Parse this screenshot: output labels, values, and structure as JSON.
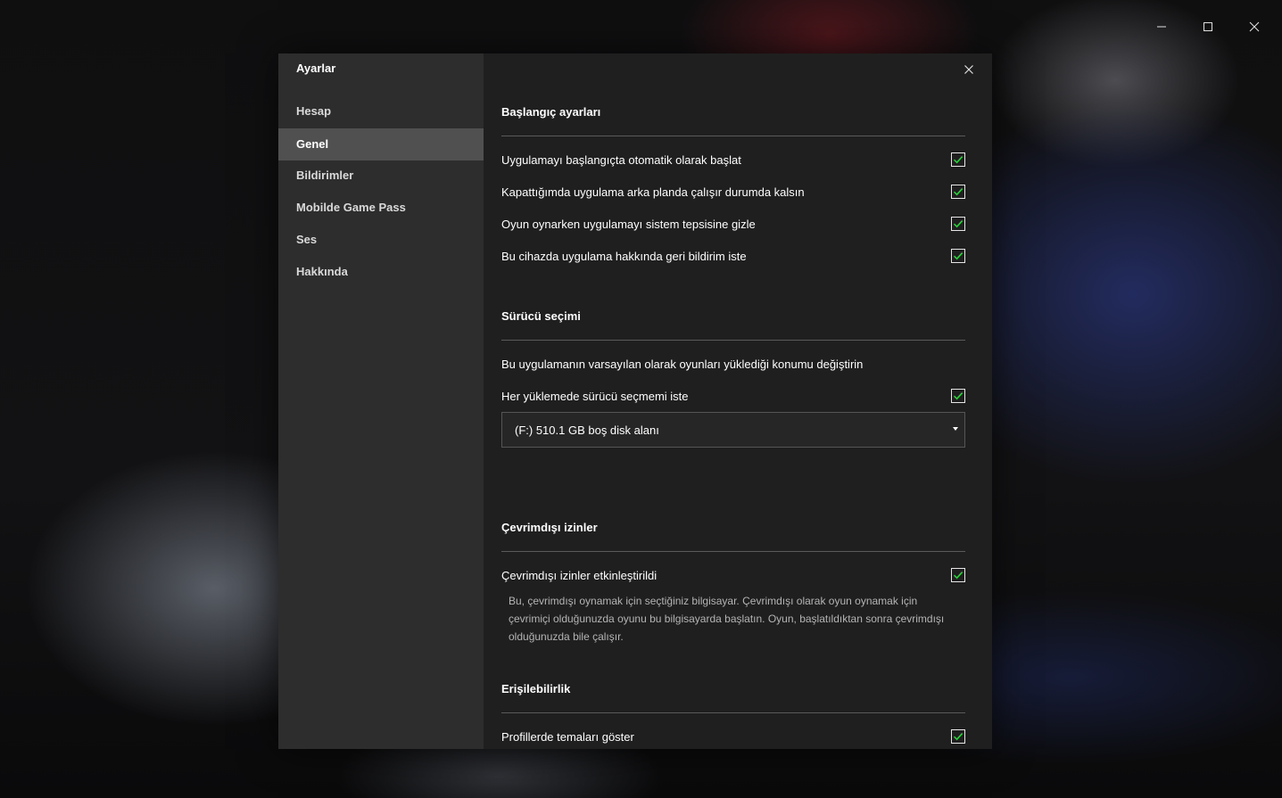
{
  "window_controls": {
    "minimize_icon": "minimize-icon",
    "maximize_icon": "maximize-icon",
    "close_icon": "close-icon"
  },
  "sidebar": {
    "title": "Ayarlar",
    "items": [
      {
        "label": "Hesap",
        "active": false
      },
      {
        "label": "Genel",
        "active": true
      },
      {
        "label": "Bildirimler",
        "active": false
      },
      {
        "label": "Mobilde Game Pass",
        "active": false
      },
      {
        "label": "Ses",
        "active": false
      },
      {
        "label": "Hakkında",
        "active": false
      }
    ]
  },
  "sections": {
    "startup": {
      "title": "Başlangıç ayarları",
      "options": [
        {
          "label": "Uygulamayı başlangıçta otomatik olarak başlat",
          "checked": true
        },
        {
          "label": "Kapattığımda uygulama arka planda çalışır durumda kalsın",
          "checked": true
        },
        {
          "label": "Oyun oynarken uygulamayı sistem tepsisine gizle",
          "checked": true
        },
        {
          "label": "Bu cihazda uygulama hakkında geri bildirim iste",
          "checked": true
        }
      ]
    },
    "drive": {
      "title": "Sürücü seçimi",
      "info": "Bu uygulamanın varsayılan olarak oyunları yüklediği konumu değiştirin",
      "ask_label": "Her yüklemede sürücü seçmemi iste",
      "ask_checked": true,
      "selected_drive": "(F:) 510.1 GB boş disk alanı"
    },
    "offline": {
      "title": "Çevrimdışı izinler",
      "toggle_label": "Çevrimdışı izinler etkinleştirildi",
      "toggle_checked": true,
      "description": "Bu, çevrimdışı oynamak için seçtiğiniz bilgisayar. Çevrimdışı olarak oyun oynamak için çevrimiçi olduğunuzda oyunu bu bilgisayarda başlatın. Oyun, başlatıldıktan sonra çevrimdışı olduğunuzda bile çalışır."
    },
    "accessibility": {
      "title": "Erişilebilirlik",
      "themes_label": "Profillerde temaları göster",
      "themes_checked": true
    }
  },
  "colors": {
    "check_green": "#2bd13a",
    "sidebar_bg": "#2d2d2d",
    "content_bg": "#1f1f1f",
    "active_item_bg": "#505050"
  }
}
